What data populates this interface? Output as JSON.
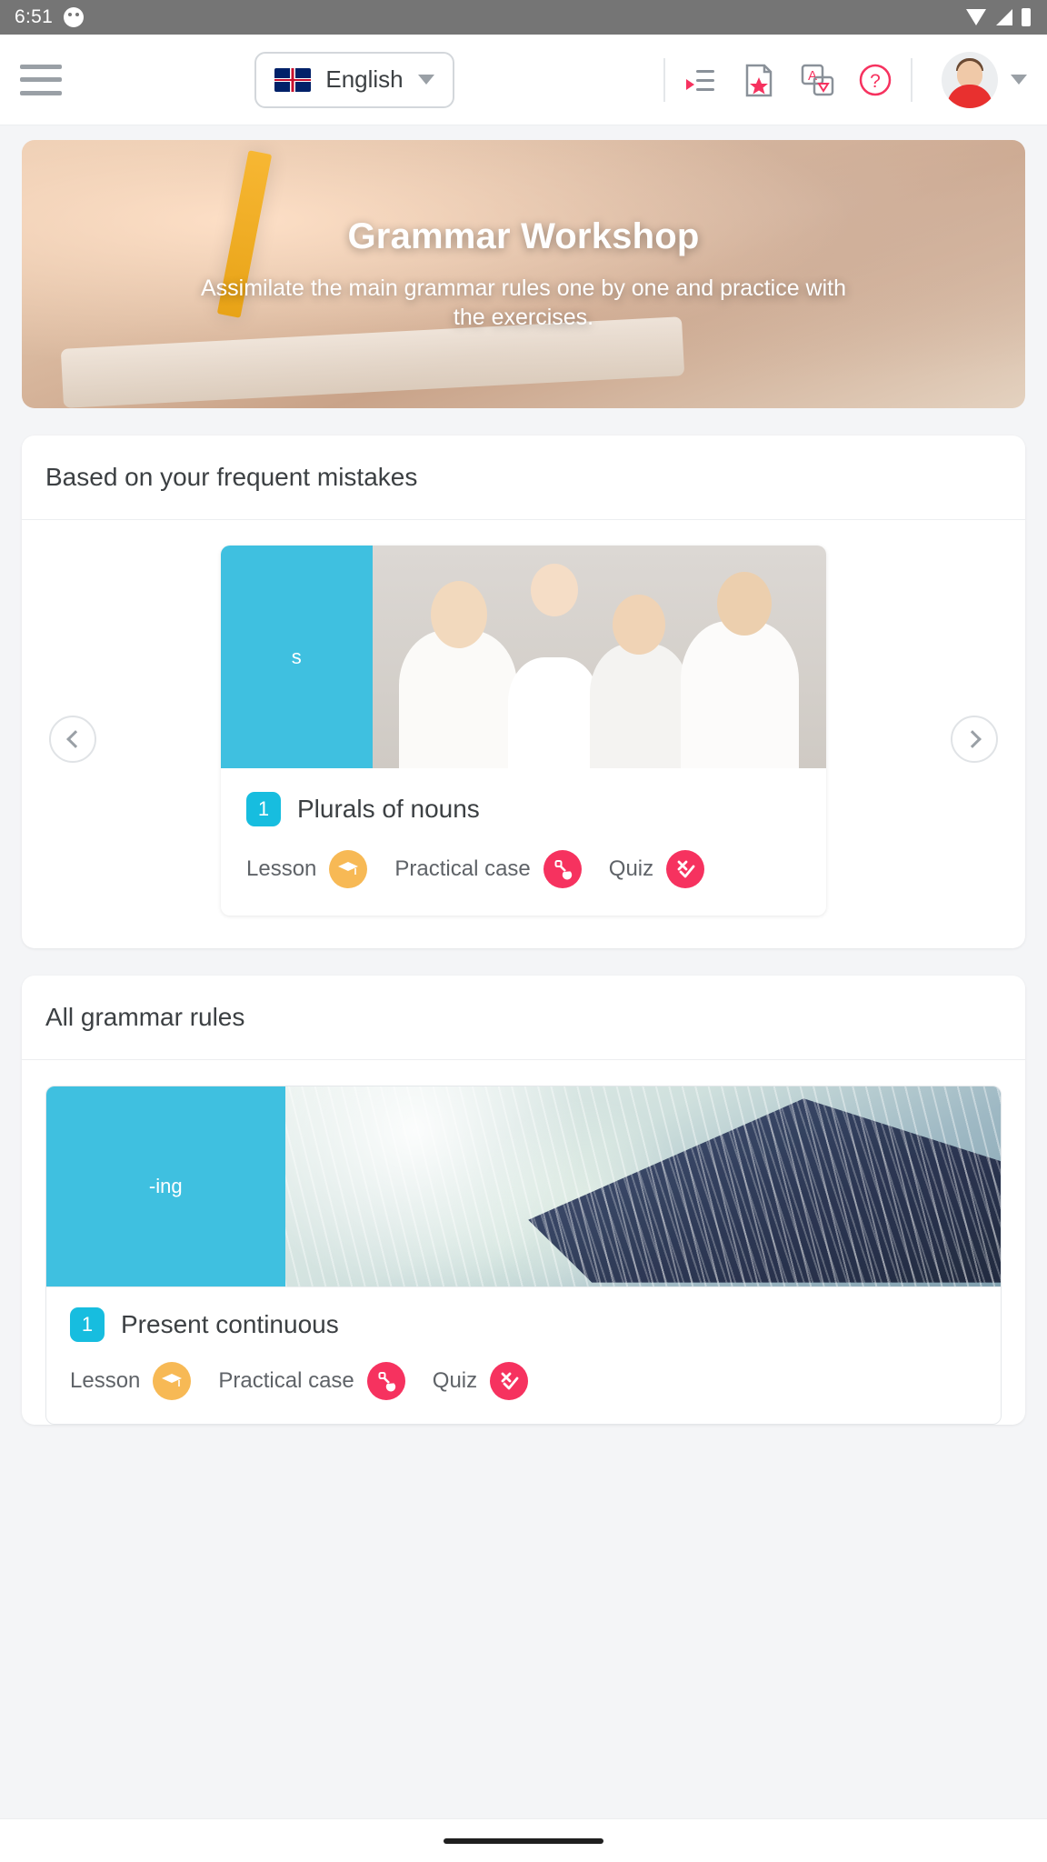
{
  "status_bar": {
    "time": "6:51",
    "icons": [
      "ghost-icon",
      "wifi-icon",
      "signal-icon",
      "battery-icon"
    ]
  },
  "header": {
    "menu_icon": "hamburger-icon",
    "language": {
      "label": "English",
      "flag": "uk-flag-icon",
      "caret": "chevron-down-icon"
    },
    "tools": [
      {
        "name": "playlist-icon",
        "label": "Playlist"
      },
      {
        "name": "starred-document-icon",
        "label": "Favourites"
      },
      {
        "name": "translation-card-icon",
        "label": "Translator"
      },
      {
        "name": "help-icon",
        "label": "Help"
      }
    ],
    "avatar": "user-avatar",
    "avatar_caret": "chevron-down-icon"
  },
  "banner": {
    "title": "Grammar Workshop",
    "subtitle": "Assimilate the main grammar rules one by one and practice with the exercises."
  },
  "sections": [
    {
      "heading": "Based on your frequent mistakes",
      "carousel": {
        "prev": "chevron-left-icon",
        "next": "chevron-right-icon"
      },
      "card": {
        "tag": "s",
        "badge": "1",
        "title": "Plurals of nouns",
        "actions": [
          {
            "label": "Lesson",
            "icon": "graduation-cap-icon",
            "color": "#f7b955"
          },
          {
            "label": "Practical case",
            "icon": "shovel-icon",
            "color": "#f6325f"
          },
          {
            "label": "Quiz",
            "icon": "check-cross-icon",
            "color": "#f6325f"
          }
        ]
      }
    },
    {
      "heading": "All grammar rules",
      "card": {
        "tag": "-ing",
        "badge": "1",
        "title": "Present continuous",
        "actions": [
          {
            "label": "Lesson",
            "icon": "graduation-cap-icon",
            "color": "#f7b955"
          },
          {
            "label": "Practical case",
            "icon": "shovel-icon",
            "color": "#f6325f"
          },
          {
            "label": "Quiz",
            "icon": "check-cross-icon",
            "color": "#f6325f"
          }
        ]
      }
    }
  ],
  "colors": {
    "accent_cyan": "#3fc0e0",
    "badge_cyan": "#17bddf",
    "accent_pink": "#f6325f",
    "accent_orange": "#f7b955",
    "text_dark": "#3c4043",
    "page_bg": "#f4f5f7"
  },
  "nav_bar": {
    "home_pill": "home-indicator"
  }
}
